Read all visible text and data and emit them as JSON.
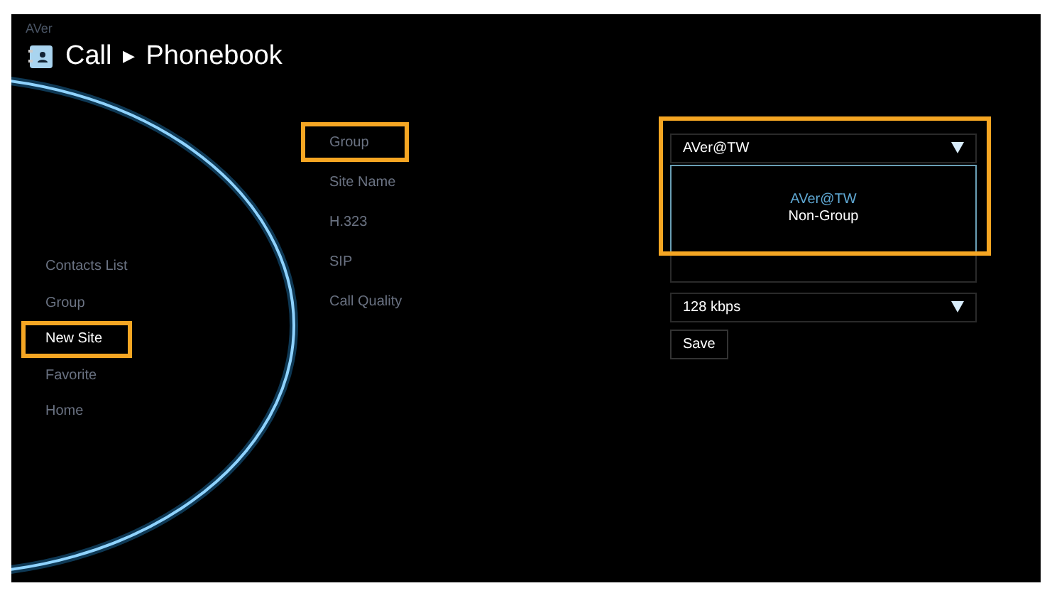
{
  "brand": "AVer",
  "breadcrumb": [
    "Call",
    "Phonebook"
  ],
  "breadcrumb_separator": "▶",
  "sidebar": {
    "items": [
      {
        "label": "Contacts List",
        "selected": false,
        "highlighted": false
      },
      {
        "label": "Group",
        "selected": false,
        "highlighted": false
      },
      {
        "label": "New Site",
        "selected": true,
        "highlighted": true
      },
      {
        "label": "Favorite",
        "selected": false,
        "highlighted": false
      },
      {
        "label": "Home",
        "selected": false,
        "highlighted": false
      }
    ]
  },
  "form": {
    "fields": [
      {
        "label": "Group",
        "kind": "select",
        "value": "AVer@TW",
        "highlighted": true,
        "expanded": true,
        "options": [
          {
            "label": "AVer@TW",
            "selected": true
          },
          {
            "label": "Non-Group",
            "selected": false
          }
        ]
      },
      {
        "label": "Site Name",
        "kind": "text",
        "highlighted": false
      },
      {
        "label": "H.323",
        "kind": "text",
        "highlighted": false
      },
      {
        "label": "SIP",
        "kind": "text",
        "highlighted": false
      },
      {
        "label": "Call Quality",
        "kind": "select",
        "value": "128 kbps",
        "highlighted": false,
        "expanded": false
      }
    ],
    "save_button": "Save"
  }
}
